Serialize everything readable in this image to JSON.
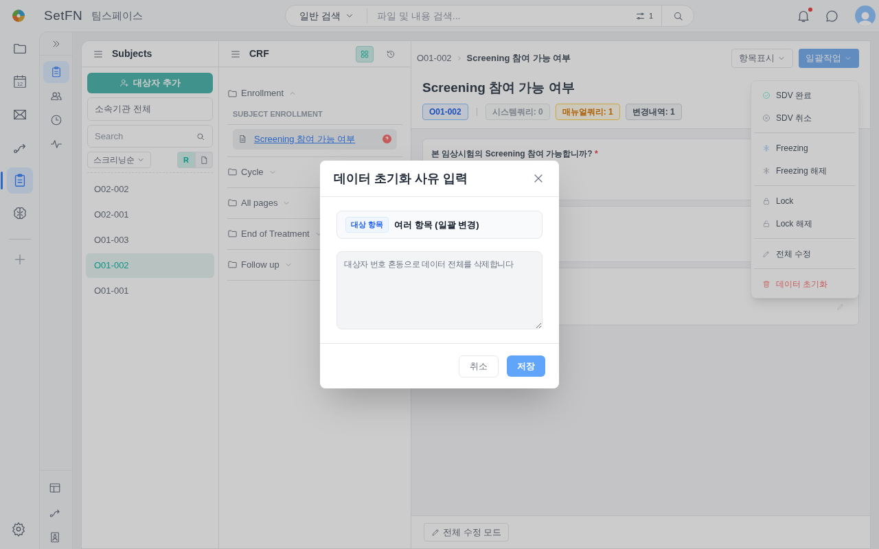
{
  "topbar": {
    "brand": "SetFN",
    "workspace": "팀스페이스",
    "search": {
      "scope": "일반 검색",
      "placeholder": "파일 및 내용 검색...",
      "filter_count": "1"
    },
    "notification_unread": true
  },
  "rail": [
    {
      "selected": false
    },
    {
      "label": "12",
      "selected": false
    },
    {
      "selected": false
    },
    {
      "selected": false
    },
    {
      "selected": true
    },
    {
      "selected": false
    }
  ],
  "subnav": [
    {
      "selected": true
    },
    {
      "selected": false
    },
    {
      "selected": false
    },
    {
      "selected": false
    }
  ],
  "subjects": {
    "title": "Subjects",
    "add_button": "대상자 추가",
    "institution": "소속기관 전체",
    "search_placeholder": "Search",
    "sort": "스크리닝순",
    "filters": [
      {
        "label": "R",
        "selected": true
      },
      {
        "selected": false
      }
    ],
    "items": [
      {
        "id": "O02-002",
        "selected": false
      },
      {
        "id": "O02-001",
        "selected": false
      },
      {
        "id": "O01-003",
        "selected": false
      },
      {
        "id": "O01-002",
        "selected": true
      },
      {
        "id": "O01-001",
        "selected": false
      }
    ]
  },
  "crf": {
    "title": "CRF",
    "views": [
      {
        "selected": true
      },
      {
        "selected": false
      }
    ],
    "sections": [
      {
        "name": "Enrollment",
        "expanded": true,
        "group": "SUBJECT ENROLLMENT",
        "pages": [
          {
            "name": "Screening 참여 가능 여부",
            "selected": true,
            "has_query": true
          }
        ]
      },
      {
        "name": "Cycle",
        "expanded": false
      },
      {
        "name": "All pages",
        "expanded": false
      },
      {
        "name": "End of Treatment",
        "expanded": false
      },
      {
        "name": "Follow up",
        "expanded": false
      }
    ]
  },
  "main": {
    "breadcrumb": [
      "O01-002",
      "Screening 참여 가능 여부"
    ],
    "title": "Screening 참여 가능 여부",
    "badges": [
      {
        "text": "O01-002",
        "kind": "subject"
      },
      {
        "text": "시스템쿼리: 0",
        "kind": "system"
      },
      {
        "text": "매뉴얼쿼리: 1",
        "kind": "manual"
      },
      {
        "text": "변경내역: 1",
        "kind": "history"
      }
    ],
    "question": "본 임상시험의 Screening 참여 가능합니까?",
    "required_mark": "*",
    "display_button": "항목표시",
    "bulk_button": "일괄작업",
    "bulk_menu": [
      {
        "label": "SDV 완료",
        "danger": false
      },
      {
        "label": "SDV 취소",
        "danger": false
      },
      {
        "label": "Freezing",
        "danger": false
      },
      {
        "label": "Freezing 해제",
        "danger": false
      },
      {
        "label": "Lock",
        "danger": false
      },
      {
        "label": "Lock 해제",
        "danger": false
      },
      {
        "label": "전체 수정",
        "danger": false
      },
      {
        "label": "데이터 초기화",
        "danger": true
      }
    ],
    "edit_mode_button": "전체 수정 모드"
  },
  "modal": {
    "title": "데이터 초기화 사유 입력",
    "target_label": "대상 항목",
    "target_value": "여러 항목 (일괄 변경)",
    "reason": "대상자 번호 혼동으로 데이터 전체를 삭제합니다",
    "buttons": {
      "cancel": "취소",
      "save": "저장"
    }
  }
}
